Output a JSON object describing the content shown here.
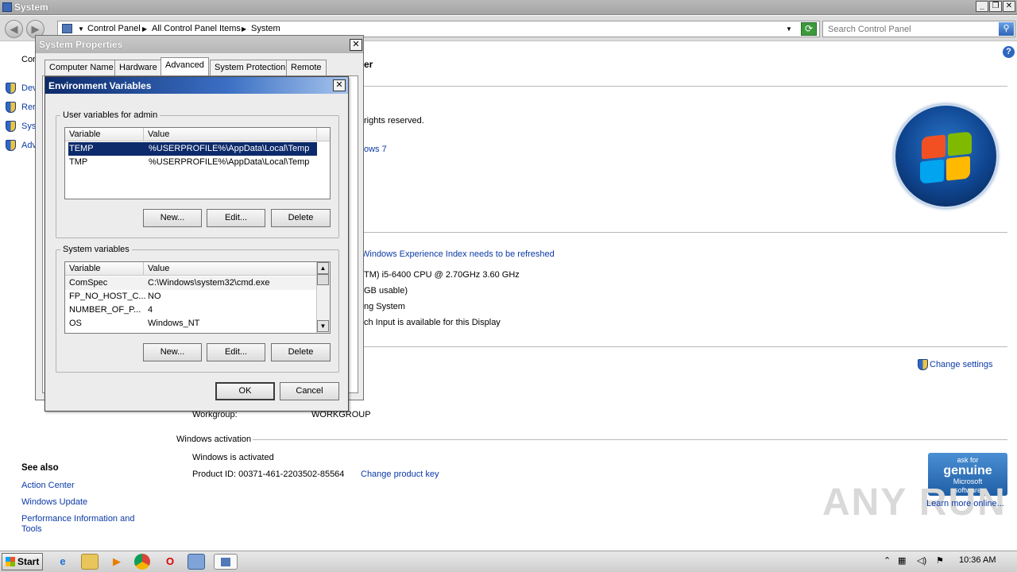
{
  "window": {
    "title": "System"
  },
  "address": {
    "breadcrumbs": [
      "Control Panel",
      "All Control Panel Items",
      "System"
    ],
    "search_placeholder": "Search Control Panel"
  },
  "left_panel": {
    "header_partial": "Cor",
    "items_partial": [
      "Dev",
      "Rer",
      "Sys",
      "Adv"
    ],
    "see_also_title": "See also",
    "see_also": [
      "Action Center",
      "Windows Update",
      "Performance Information and Tools"
    ]
  },
  "main": {
    "heading_partial": "er",
    "copyright_partial": "rights reserved.",
    "edition_partial": "ows 7",
    "experience_link": "Windows Experience Index needs to be refreshed",
    "processor_partial": "TM) i5-6400 CPU @ 2.70GHz   3.60 GHz",
    "ram_partial": "GB usable)",
    "systype_partial": "ng System",
    "pen_partial": "ch Input is available for this Display",
    "change_settings": "Change settings",
    "workgroup_label": "Workgroup:",
    "workgroup_value": "WORKGROUP",
    "activation_header": "Windows activation",
    "activation_status": "Windows is activated",
    "product_id": "Product ID:  00371-461-2203502-85564",
    "change_key": "Change product key",
    "genuine": {
      "line1": "ask for",
      "line2": "genuine",
      "line3": "Microsoft",
      "line4": "software"
    },
    "learn_more": "Learn more online..."
  },
  "watermark": "ANY RUN",
  "system_properties": {
    "title": "System Properties",
    "tabs": [
      "Computer Name",
      "Hardware",
      "Advanced",
      "System Protection",
      "Remote"
    ],
    "active_tab": "Advanced"
  },
  "env_vars": {
    "title": "Environment Variables",
    "user_group_label": "User variables for admin",
    "system_group_label": "System variables",
    "col_variable": "Variable",
    "col_value": "Value",
    "user_rows": [
      {
        "name": "TEMP",
        "value": "%USERPROFILE%\\AppData\\Local\\Temp",
        "selected": true
      },
      {
        "name": "TMP",
        "value": "%USERPROFILE%\\AppData\\Local\\Temp",
        "selected": false
      }
    ],
    "system_rows": [
      {
        "name": "ComSpec",
        "value": "C:\\Windows\\system32\\cmd.exe"
      },
      {
        "name": "FP_NO_HOST_C...",
        "value": "NO"
      },
      {
        "name": "NUMBER_OF_P...",
        "value": "4"
      },
      {
        "name": "OS",
        "value": "Windows_NT"
      }
    ],
    "buttons": {
      "new": "New...",
      "edit": "Edit...",
      "delete": "Delete",
      "ok": "OK",
      "cancel": "Cancel"
    }
  },
  "taskbar": {
    "start": "Start",
    "clock": "10:36 AM"
  }
}
